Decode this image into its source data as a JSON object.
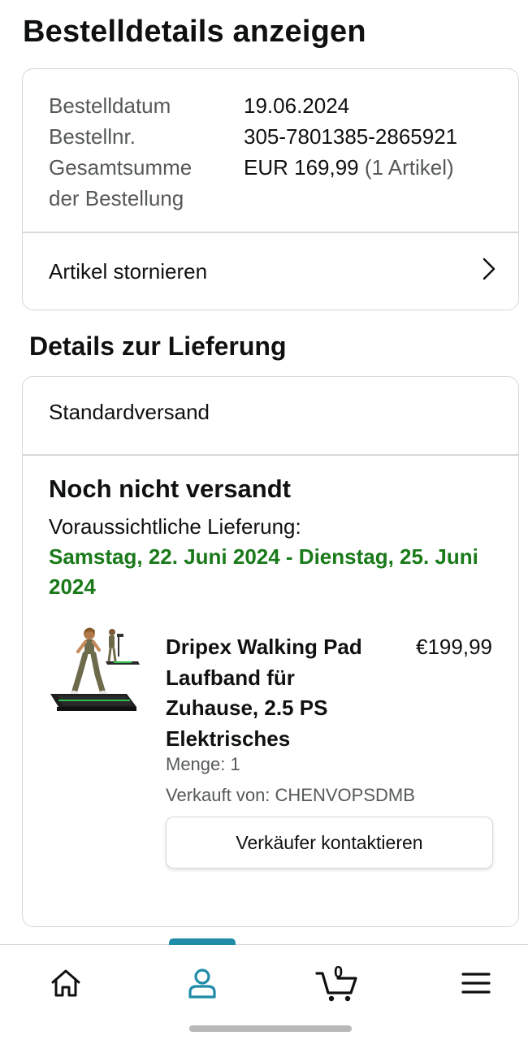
{
  "page": {
    "title": "Bestelldetails anzeigen"
  },
  "summary": {
    "rows": [
      {
        "label": "Bestelldatum",
        "value": "19.06.2024"
      },
      {
        "label": "Bestellnr.",
        "value": "305-7801385-2865921"
      }
    ],
    "total_label_line1": "Gesamtsumme",
    "total_label_line2": "der Bestellung",
    "total_value": "EUR 169,99",
    "total_items": "(1 Artikel)",
    "cancel_label": "Artikel stornieren"
  },
  "delivery": {
    "section_title": "Details zur Lieferung",
    "shipping_method": "Standardversand",
    "status": "Noch nicht versandt",
    "eta_label": "Voraussichtliche Lieferung:",
    "eta_dates": "Samstag, 22. Juni 2024 - Dienstag, 25. Juni 2024",
    "product": {
      "name": "Dripex Walking Pad Laufband für Zuhause, 2.5 PS Elektrisches",
      "price": "€199,99",
      "quantity": "Menge: 1",
      "seller": "Verkauft von: CHENVOPSDMB",
      "image_icon": "treadmill-product-image"
    },
    "contact_button": "Verkäufer kontaktieren"
  },
  "nav": {
    "items": [
      {
        "name": "home",
        "icon": "home-icon"
      },
      {
        "name": "account",
        "icon": "person-icon",
        "active": true
      },
      {
        "name": "cart",
        "icon": "cart-icon",
        "count": "0"
      },
      {
        "name": "menu",
        "icon": "hamburger-icon"
      }
    ]
  },
  "colors": {
    "accent": "#1f8ca8",
    "delivery_green": "#1a7a1a",
    "border": "#d5d9d9",
    "muted_text": "#565959"
  }
}
